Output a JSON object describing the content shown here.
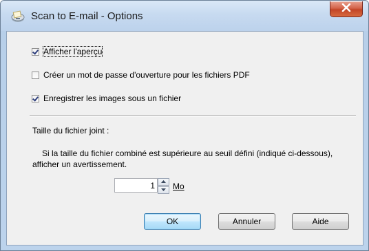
{
  "window": {
    "title": "Scan to E-mail - Options",
    "close_icon": "close-icon",
    "app_icon": "scanner-icon"
  },
  "options": [
    {
      "label": "Afficher l'aperçu",
      "checked": true
    },
    {
      "label": "Créer un mot de passe d'ouverture pour les fichiers PDF",
      "checked": false
    },
    {
      "label": "Enregistrer les images sous un fichier",
      "checked": true
    }
  ],
  "attachment": {
    "heading": "Taille du fichier joint :",
    "description": "Si la taille du fichier combiné est supérieure au seuil défini (indiqué ci-dessous), afficher un avertissement.",
    "value": "1",
    "unit": "Mo"
  },
  "buttons": {
    "ok": "OK",
    "cancel": "Annuler",
    "help": "Aide"
  },
  "colors": {
    "titlebar": "#c7daf0",
    "close_button": "#c24527",
    "dialog_bg": "#f0f0f0",
    "default_button": "#bee6fd"
  }
}
